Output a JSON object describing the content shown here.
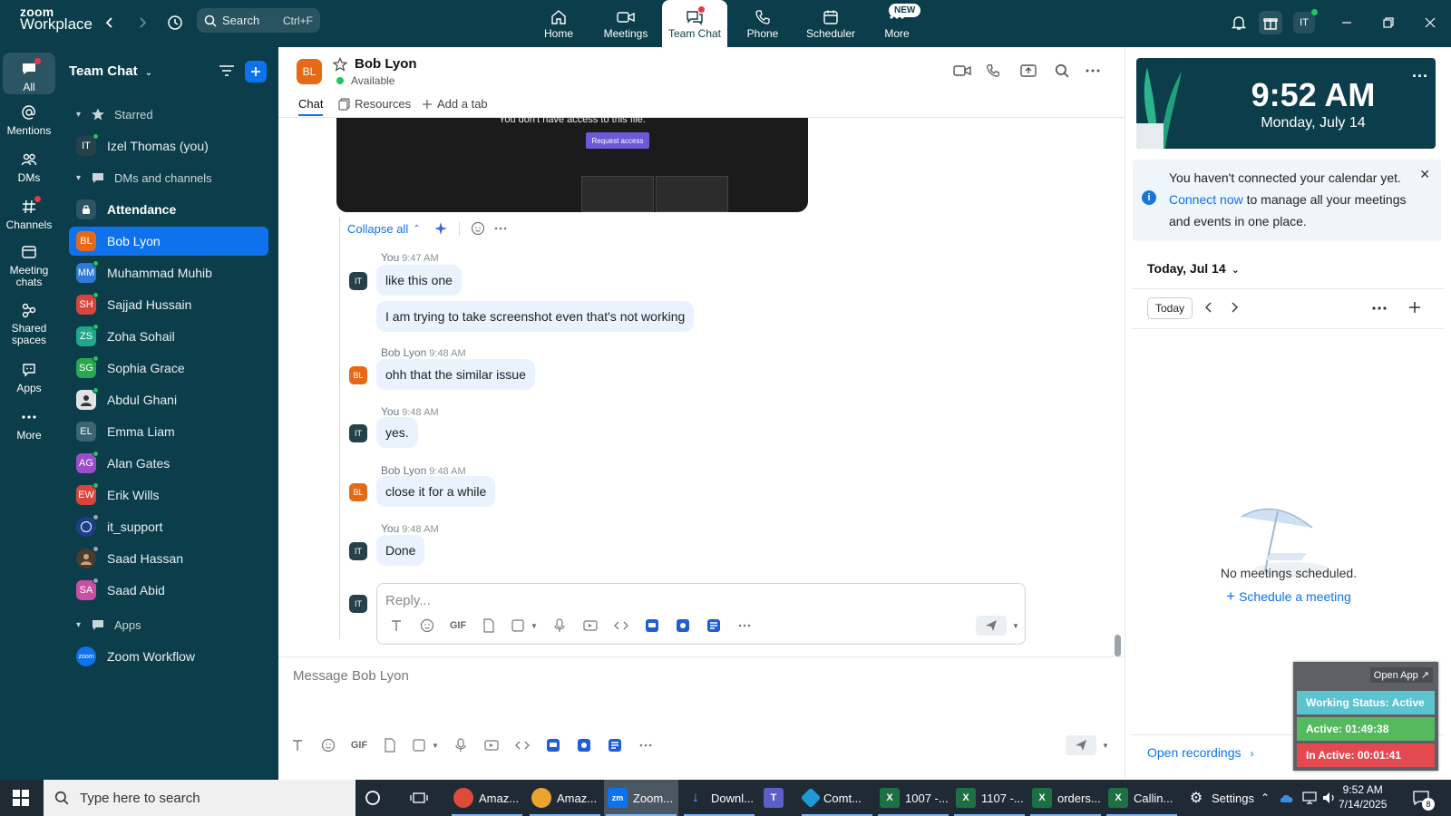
{
  "topbar": {
    "logo_line1": "zoom",
    "logo_line2": "Workplace",
    "search_label": "Search",
    "search_shortcut": "Ctrl+F",
    "tabs": [
      {
        "label": "Home"
      },
      {
        "label": "Meetings"
      },
      {
        "label": "Team Chat"
      },
      {
        "label": "Phone"
      },
      {
        "label": "Scheduler"
      },
      {
        "label": "More"
      }
    ],
    "new_badge": "NEW",
    "user_initials": "IT"
  },
  "rail": {
    "items": [
      {
        "label": "All"
      },
      {
        "label": "Mentions"
      },
      {
        "label": "DMs"
      },
      {
        "label": "Channels"
      },
      {
        "label": "Meeting chats"
      },
      {
        "label": "Shared spaces"
      },
      {
        "label": "Apps"
      },
      {
        "label": "More"
      }
    ]
  },
  "sidebar": {
    "title": "Team Chat",
    "starred_label": "Starred",
    "starred": [
      {
        "initials": "IT",
        "name": "Izel Thomas (you)"
      }
    ],
    "dms_label": "DMs and channels",
    "dms": [
      {
        "initials": "",
        "name": "Attendance"
      },
      {
        "initials": "BL",
        "name": "Bob Lyon"
      },
      {
        "initials": "MM",
        "name": "Muhammad Muhib"
      },
      {
        "initials": "SH",
        "name": "Sajjad Hussain"
      },
      {
        "initials": "ZS",
        "name": "Zoha Sohail"
      },
      {
        "initials": "SG",
        "name": "Sophia Grace"
      },
      {
        "initials": "",
        "name": "Abdul Ghani"
      },
      {
        "initials": "EL",
        "name": "Emma Liam"
      },
      {
        "initials": "AG",
        "name": "Alan Gates"
      },
      {
        "initials": "EW",
        "name": "Erik Wills"
      },
      {
        "initials": "",
        "name": "it_support"
      },
      {
        "initials": "",
        "name": "Saad Hassan"
      },
      {
        "initials": "SA",
        "name": "Saad Abid"
      }
    ],
    "apps_label": "Apps",
    "apps": [
      {
        "initials": "zoom",
        "name": "Zoom Workflow"
      }
    ]
  },
  "chat": {
    "contact_initials": "BL",
    "contact_name": "Bob Lyon",
    "contact_status": "Available",
    "tabs": [
      {
        "label": "Chat"
      },
      {
        "label": "Resources"
      },
      {
        "label": "Add a tab"
      }
    ],
    "preview_text": "You don't have access to this file.",
    "preview_button": "Request access",
    "collapse_label": "Collapse all",
    "messages": [
      {
        "initials": "IT",
        "sender": "You",
        "time": "9:47 AM",
        "texts": [
          "like this one",
          "I am trying to take screenshot even that's not working"
        ]
      },
      {
        "initials": "BL",
        "sender": "Bob Lyon",
        "time": "9:48 AM",
        "texts": [
          "ohh that the similar issue"
        ]
      },
      {
        "initials": "IT",
        "sender": "You",
        "time": "9:48 AM",
        "texts": [
          "yes."
        ]
      },
      {
        "initials": "BL",
        "sender": "Bob Lyon",
        "time": "9:48 AM",
        "texts": [
          "close it for a while"
        ]
      },
      {
        "initials": "IT",
        "sender": "You",
        "time": "9:48 AM",
        "texts": [
          "Done"
        ]
      }
    ],
    "reply_placeholder": "Reply...",
    "reply_avatar": "IT",
    "composer_placeholder": "Message Bob Lyon",
    "gif_label": "GIF"
  },
  "right": {
    "time": "9:52 AM",
    "date": "Monday, July 14",
    "cal_text_1": "You haven't connected your calendar yet.",
    "cal_link": "Connect now",
    "cal_text_2": "to manage all your meetings and events in one place.",
    "today_heading": "Today, Jul 14",
    "today_button": "Today",
    "no_meetings": "No meetings scheduled.",
    "schedule_link": "Schedule a meeting",
    "open_recordings": "Open recordings"
  },
  "widget": {
    "open_app": "Open App ↗",
    "working_status": "Working Status: Active",
    "active_time": "Active: 01:49:38",
    "inactive_time": "In Active: 00:01:41"
  },
  "taskbar": {
    "search_placeholder": "Type here to search",
    "items": [
      {
        "label": "Amaz..."
      },
      {
        "label": "Amaz..."
      },
      {
        "label": "Zoom..."
      },
      {
        "label": "Downl..."
      },
      {
        "label": ""
      },
      {
        "label": "Comt..."
      },
      {
        "label": "1007 -..."
      },
      {
        "label": "1107 -..."
      },
      {
        "label": "orders..."
      },
      {
        "label": "Callin..."
      },
      {
        "label": "Settings"
      }
    ],
    "time": "9:52 AM",
    "date": "7/14/2025",
    "notif_count": "8"
  }
}
